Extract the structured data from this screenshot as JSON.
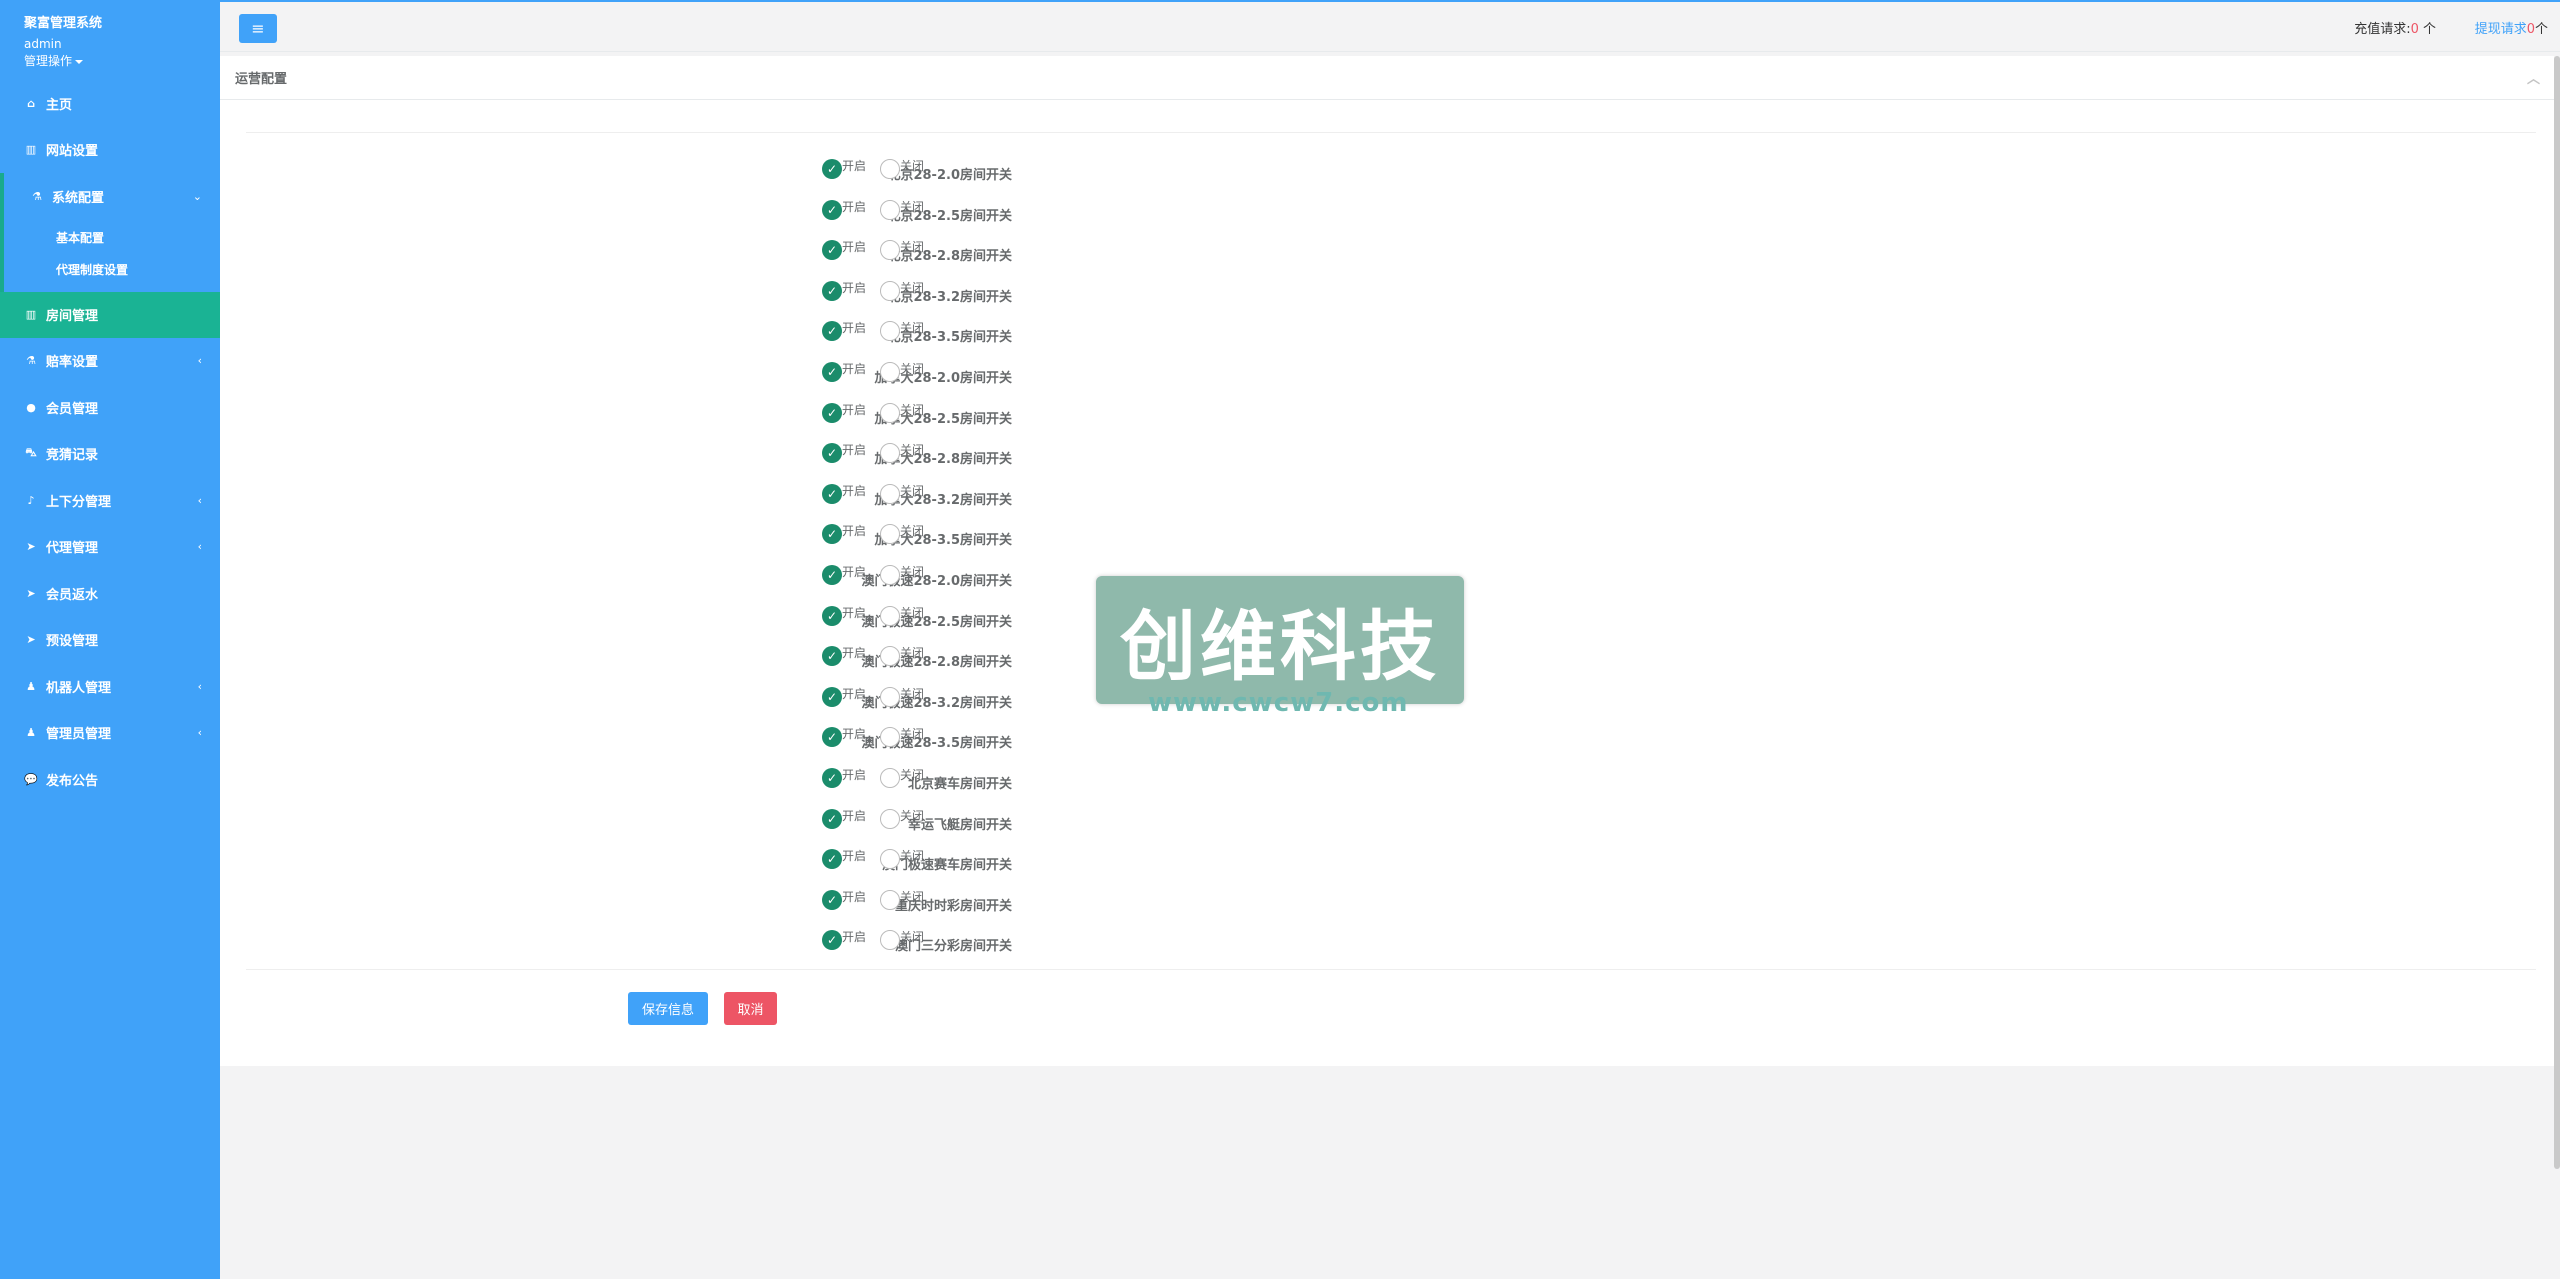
{
  "sidebar": {
    "system_name": "聚富管理系统",
    "user": "admin",
    "ops": "管理操作",
    "items": [
      {
        "label": "主页",
        "icon": "home-icon",
        "glyph": "⌂"
      },
      {
        "label": "网站设置",
        "icon": "columns-icon",
        "glyph": "▥"
      },
      {
        "label": "系统配置",
        "icon": "flask-icon",
        "glyph": "⚗",
        "arrow": "⌄"
      },
      {
        "label": "房间管理",
        "icon": "columns-icon",
        "glyph": "▥"
      },
      {
        "label": "赔率设置",
        "icon": "flask-icon",
        "glyph": "⚗",
        "arrow": "‹"
      },
      {
        "label": "会员管理",
        "icon": "user-icon",
        "glyph": "●"
      },
      {
        "label": "竞猜记录",
        "icon": "car-icon",
        "glyph": "⛍"
      },
      {
        "label": "上下分管理",
        "icon": "music-icon",
        "glyph": "♪",
        "arrow": "‹"
      },
      {
        "label": "代理管理",
        "icon": "paper-plane-icon",
        "glyph": "➤",
        "arrow": "‹"
      },
      {
        "label": "会员返水",
        "icon": "paper-plane-icon",
        "glyph": "➤"
      },
      {
        "label": "预设管理",
        "icon": "paper-plane-icon",
        "glyph": "➤"
      },
      {
        "label": "机器人管理",
        "icon": "male-icon",
        "glyph": "♟",
        "arrow": "‹"
      },
      {
        "label": "管理员管理",
        "icon": "male-icon",
        "glyph": "♟",
        "arrow": "‹"
      },
      {
        "label": "发布公告",
        "icon": "comments-icon",
        "glyph": "💬"
      }
    ],
    "sub_items": [
      "基本配置",
      "代理制度设置"
    ]
  },
  "topbar": {
    "menu_glyph": "≡",
    "recharge_label": "充值请求:",
    "recharge_count": "0",
    "recharge_unit": " 个",
    "withdraw_label": "提现请求",
    "withdraw_count": "0",
    "withdraw_unit": "个"
  },
  "panel": {
    "title": "运营配置",
    "collapse_glyph": "︿",
    "on_label": "开启",
    "off_label": "关闭",
    "rows": [
      {
        "label": "北京28-2.0房间开关",
        "value": "on"
      },
      {
        "label": "北京28-2.5房间开关",
        "value": "on"
      },
      {
        "label": "北京28-2.8房间开关",
        "value": "on"
      },
      {
        "label": "北京28-3.2房间开关",
        "value": "on"
      },
      {
        "label": "北京28-3.5房间开关",
        "value": "on"
      },
      {
        "label": "加拿大28-2.0房间开关",
        "value": "on"
      },
      {
        "label": "加拿大28-2.5房间开关",
        "value": "on"
      },
      {
        "label": "加拿大28-2.8房间开关",
        "value": "on"
      },
      {
        "label": "加拿大28-3.2房间开关",
        "value": "on"
      },
      {
        "label": "加拿大28-3.5房间开关",
        "value": "on"
      },
      {
        "label": "澳门极速28-2.0房间开关",
        "value": "on"
      },
      {
        "label": "澳门极速28-2.5房间开关",
        "value": "on"
      },
      {
        "label": "澳门极速28-2.8房间开关",
        "value": "on"
      },
      {
        "label": "澳门极速28-3.2房间开关",
        "value": "on"
      },
      {
        "label": "澳门极速28-3.5房间开关",
        "value": "on"
      },
      {
        "label": "北京赛车房间开关",
        "value": "on"
      },
      {
        "label": "幸运飞艇房间开关",
        "value": "on"
      },
      {
        "label": "澳门极速赛车房间开关",
        "value": "on"
      },
      {
        "label": "重庆时时彩房间开关",
        "value": "on"
      },
      {
        "label": "澳门三分彩房间开关",
        "value": "on"
      }
    ],
    "save_label": "保存信息",
    "cancel_label": "取消"
  },
  "watermark": {
    "text": "创维科技",
    "url": "www.cwcw7.com"
  },
  "colors": {
    "sidebar": "#40a2f9",
    "active": "#1ab394",
    "checked": "#1b8c6b",
    "danger": "#ed5565"
  }
}
